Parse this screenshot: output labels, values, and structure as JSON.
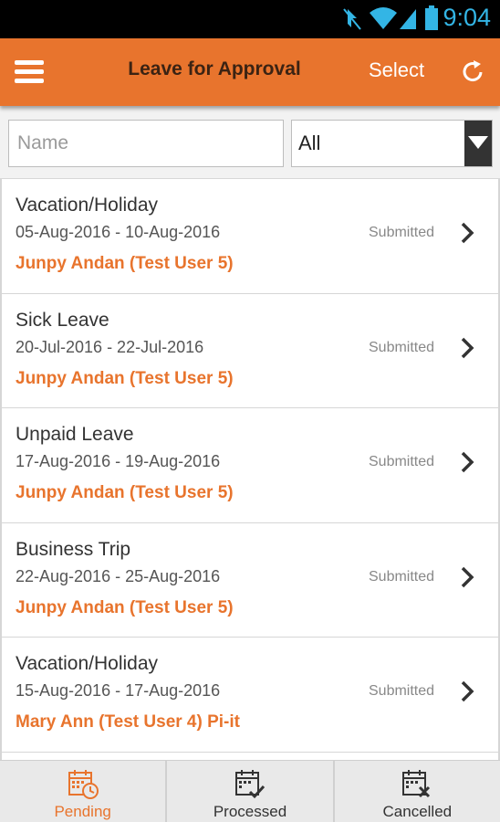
{
  "status_bar": {
    "time": "9:04",
    "icons": [
      "mute-icon",
      "wifi-icon",
      "signal-icon",
      "battery-icon"
    ]
  },
  "toolbar": {
    "title": "Leave for Approval",
    "select_label": "Select",
    "icons": [
      "menu-icon",
      "refresh-icon"
    ]
  },
  "filters": {
    "name_placeholder": "Name",
    "name_value": "",
    "status_selected": "All"
  },
  "requests": [
    {
      "leave_type": "Vacation/Holiday",
      "dates": "05-Aug-2016 - 10-Aug-2016",
      "employee": "Junpy Andan (Test User 5)",
      "status": "Submitted"
    },
    {
      "leave_type": "Sick Leave",
      "dates": "20-Jul-2016 - 22-Jul-2016",
      "employee": "Junpy Andan (Test User 5)",
      "status": "Submitted"
    },
    {
      "leave_type": "Unpaid Leave",
      "dates": "17-Aug-2016 - 19-Aug-2016",
      "employee": "Junpy Andan (Test User 5)",
      "status": "Submitted"
    },
    {
      "leave_type": "Business Trip",
      "dates": "22-Aug-2016 - 25-Aug-2016",
      "employee": "Junpy Andan (Test User 5)",
      "status": "Submitted"
    },
    {
      "leave_type": "Vacation/Holiday",
      "dates": "15-Aug-2016 - 17-Aug-2016",
      "employee": "Mary Ann (Test User 4) Pi-it",
      "status": "Submitted"
    }
  ],
  "tabs": [
    {
      "label": "Pending",
      "icon": "calendar-clock-icon",
      "active": true
    },
    {
      "label": "Processed",
      "icon": "calendar-check-icon",
      "active": false
    },
    {
      "label": "Cancelled",
      "icon": "calendar-cancel-icon",
      "active": false
    }
  ],
  "colors": {
    "accent": "#e8742d",
    "status_bar_icons": "#33b5e5"
  }
}
